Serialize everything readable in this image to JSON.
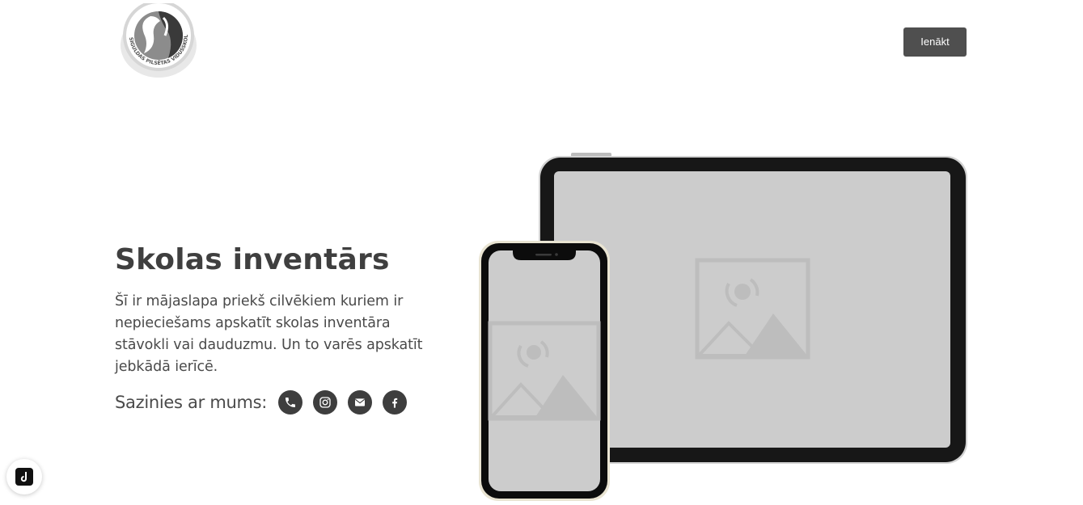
{
  "header": {
    "logo_text": "SIGULDAS PILSĒTAS VIDUSSKOLA",
    "logo_icon": "school-logo-icon",
    "login_label": "Ienākt"
  },
  "hero": {
    "title": "Skolas inventārs",
    "description": "Šī ir mājaslapa priekš cilvēkiem kuriem ir nepieciešams apskatīt skolas inventāra stāvokli vai dauduzmu. Un to varēs apskatīt jebkādā ierīcē.",
    "contact_label": "Sazinies ar mums:",
    "social_icons": [
      "phone-icon",
      "instagram-icon",
      "mail-icon",
      "facebook-icon"
    ]
  },
  "devices": {
    "tablet_icon": "image-placeholder-icon",
    "phone_icon": "image-placeholder-icon"
  },
  "colors": {
    "button_bg": "#4f4f4f",
    "text": "#3f3f3f",
    "icon_bg": "#3e3e3e",
    "screen": "#cccccc",
    "placeholder": "#bdbdbd"
  },
  "badge": {
    "icon": "app-badge-icon"
  }
}
